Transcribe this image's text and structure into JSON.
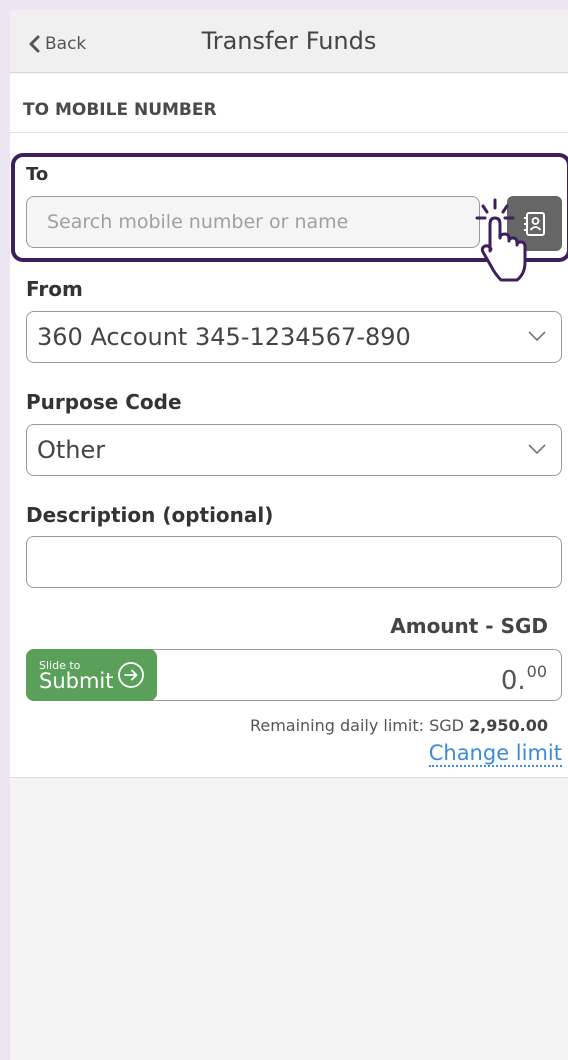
{
  "header": {
    "back_label": "Back",
    "title": "Transfer Funds"
  },
  "section": {
    "heading": "TO MOBILE NUMBER"
  },
  "to": {
    "label": "To",
    "placeholder": "Search mobile number or name",
    "contact_icon": "contact-book-icon"
  },
  "from": {
    "label": "From",
    "value": "360 Account  345-1234567-890"
  },
  "purpose": {
    "label": "Purpose Code",
    "value": "Other"
  },
  "description": {
    "label": "Description (optional)",
    "value": ""
  },
  "amount": {
    "label": "Amount - SGD",
    "value_int": "0.",
    "value_dec": "00",
    "slider_small": "Slide to",
    "slider_big": "Submit"
  },
  "limit": {
    "prefix": "Remaining daily limit: SGD ",
    "value": "2,950.00",
    "change_label": "Change limit"
  },
  "colors": {
    "highlight": "#3c1f5c",
    "submit_green": "#5aa05a",
    "link_blue": "#3b8bd9"
  }
}
